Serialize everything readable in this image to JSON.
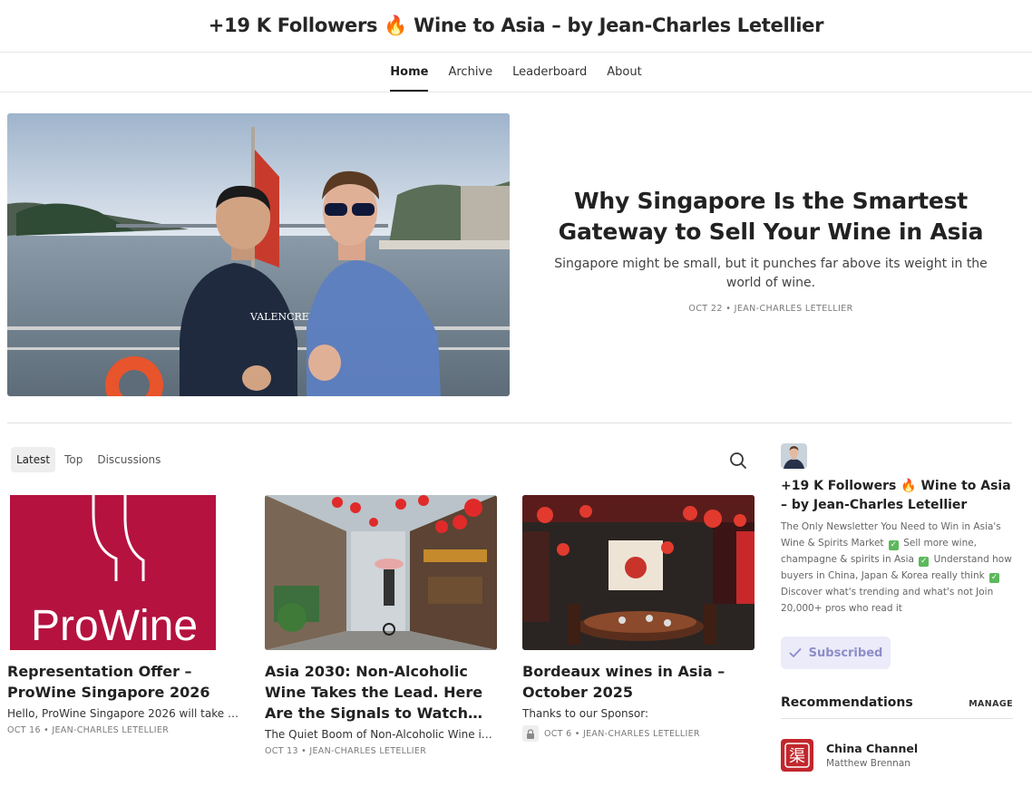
{
  "header": {
    "title": "+19 K Followers 🔥  Wine to Asia – by Jean-Charles Letellier"
  },
  "nav": {
    "items": [
      {
        "label": "Home"
      },
      {
        "label": "Archive"
      },
      {
        "label": "Leaderboard"
      },
      {
        "label": "About"
      }
    ],
    "active": "Home"
  },
  "hero": {
    "title": "Why Singapore Is the Smartest Gateway to Sell Your Wine in Asia",
    "subtitle": "Singapore might be small, but it punches far above its weight in the world of wine.",
    "meta": "OCT 22 • JEAN-CHARLES LETELLIER",
    "image_shirt_text": "VALENCREW"
  },
  "tabs": {
    "items": [
      {
        "label": "Latest"
      },
      {
        "label": "Top"
      },
      {
        "label": "Discussions"
      }
    ],
    "active": "Latest"
  },
  "posts": [
    {
      "title": "Representation Offer – ProWine Singapore 2026",
      "subtitle": "Hello, ProWine Singapore 2026 will take place…",
      "meta": "OCT 16 • JEAN-CHARLES LETELLIER",
      "image_text": "ProWine",
      "paywalled": false
    },
    {
      "title": "Asia 2030: Non-Alcoholic Wine Takes the Lead. Here Are the Signals to Watch…",
      "subtitle": "The Quiet Boom of Non-Alcoholic Wine in…",
      "meta": "OCT 13 • JEAN-CHARLES LETELLIER",
      "paywalled": false
    },
    {
      "title": "Bordeaux wines in Asia – October 2025",
      "subtitle": "Thanks to our Sponsor:",
      "meta": "OCT 6 • JEAN-CHARLES LETELLIER",
      "paywalled": true
    }
  ],
  "sidebar": {
    "pub_title": "+19 K Followers 🔥  Wine to Asia – by Jean-Charles Letellier",
    "desc_parts": [
      "The Only Newsletter You Need to Win in Asia's Wine & Spirits Market",
      "Sell more wine, champagne & spirits in Asia",
      "Understand how buyers in China, Japan & Korea really think",
      "Discover what's trending and what's not Join 20,000+ pros who read it"
    ],
    "subscribed_label": "Subscribed",
    "recommendations_title": "Recommendations",
    "manage_label": "MANAGE",
    "recommendations": [
      {
        "name": "China Channel",
        "author": "Matthew Brennan",
        "logo_char": "渠"
      }
    ]
  },
  "colors": {
    "accent": "#8d8dc8",
    "subscribed_bg": "#ebebfa",
    "prowine_red": "#b5123f",
    "check_green": "#5cb85c",
    "rec_logo_red": "#c2272d"
  }
}
